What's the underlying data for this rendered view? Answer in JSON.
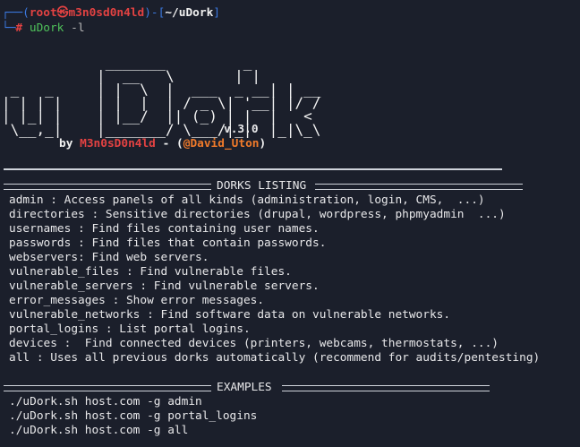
{
  "prompt": {
    "corner_top": "┌──",
    "open": "(",
    "user": "root",
    "at": "㉿",
    "host": "m3n0sd0n4ld",
    "close": ")-[",
    "path": "~/uDork",
    "end": "]",
    "corner_bottom": "└─",
    "hash": "#",
    "command": "uDork",
    "flag": "-l"
  },
  "banner": {
    "ascii_art": "            _______         _\n           |  __   \\       | |\n _   _     | |  \\  |  ___  _ __| | __\n| | | |    | |  |  | / _ \\| '__| |/ /\n| |_| |    | |__/  || (_) | |  |   <\n \\__,_|    |_______/ \\___/|_|  |_|\\_\\",
    "version": "v.3.0",
    "by": "by",
    "author": "M3n0sD0n4ld",
    "dash": "- (",
    "handle": "@David_Uton",
    "close": ")"
  },
  "dorks_header": "DORKS LISTING",
  "dorks": [
    "admin : Access panels of all kinds (administration, login, CMS,  ...)",
    "directories : Sensitive directories (drupal, wordpress, phpmyadmin  ...)",
    "usernames : Find files containing user names.",
    "passwords : Find files that contain passwords.",
    "webservers: Find web servers.",
    "vulnerable_files : Find vulnerable files.",
    "vulnerable_servers : Find vulnerable servers.",
    "error_messages : Show error messages.",
    "vulnerable_networks : Find software data on vulnerable networks.",
    "portal_logins : List portal logins.",
    "devices :  Find connected devices (printers, webcams, thermostats, ...)",
    "all : Uses all previous dorks automatically (recommend for audits/pentesting)"
  ],
  "examples_header": "EXAMPLES",
  "examples": [
    "./uDork.sh host.com -g admin",
    "./uDork.sh host.com -g portal_logins",
    "./uDork.sh host.com -g all"
  ]
}
